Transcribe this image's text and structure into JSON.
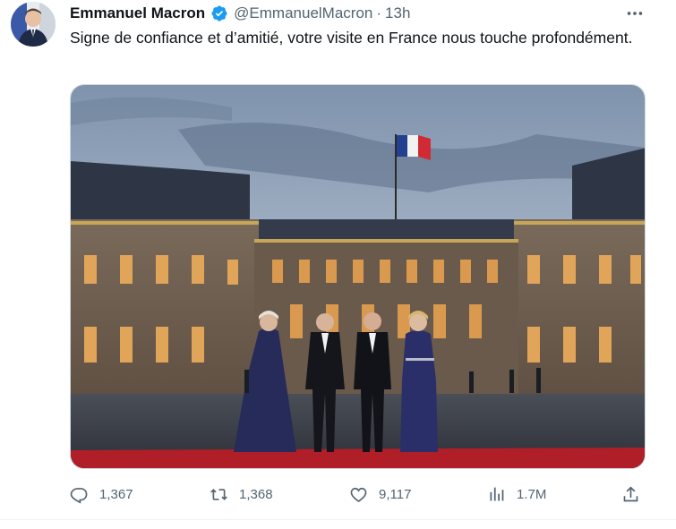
{
  "tweet": {
    "name": "Emmanuel Macron",
    "handle": "@EmmanuelMacron",
    "separator": "·",
    "time": "13h",
    "text": "Signe de confiance et d’amitié, votre visite en France nous touche profondément.",
    "colors": {
      "verified": "#1d9bf0",
      "secondary_text": "#536471",
      "primary_text": "#0f1419"
    }
  },
  "actions": {
    "replies": "1,367",
    "reposts": "1,368",
    "likes": "9,117",
    "views": "1.7M"
  },
  "icons": {
    "more": "more-horizontal-icon",
    "reply": "reply-icon",
    "repost": "repost-icon",
    "like": "heart-icon",
    "views": "views-bar-chart-icon",
    "share": "share-icon"
  }
}
